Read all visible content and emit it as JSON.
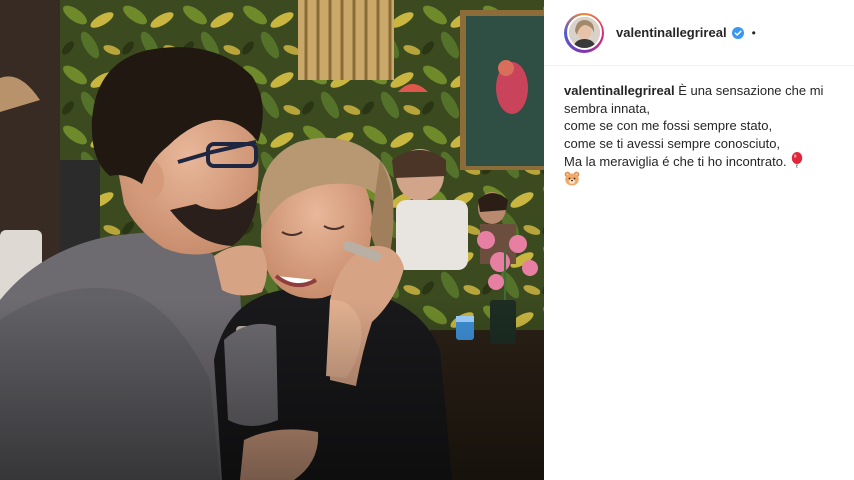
{
  "post": {
    "username": "valentinallegrireal",
    "verified": true,
    "verified_icon": "verified-badge-icon",
    "avatar_icon": "profile-avatar",
    "photo_alt": "Couple photo in restaurant",
    "caption": {
      "username": "valentinallegrireal",
      "first_line": "È una sensazione che mi sembra innata,",
      "lines": [
        "come se con me fossi sempre stato,",
        "come se ti avessi sempre conosciuto,",
        "Ma la meraviglia é che ti ho incontrato."
      ],
      "emojis": [
        "balloon-emoji",
        "bear-emoji"
      ]
    }
  },
  "colors": {
    "verified_blue": "#3897f0",
    "text": "#262626",
    "divider": "#efefef"
  }
}
